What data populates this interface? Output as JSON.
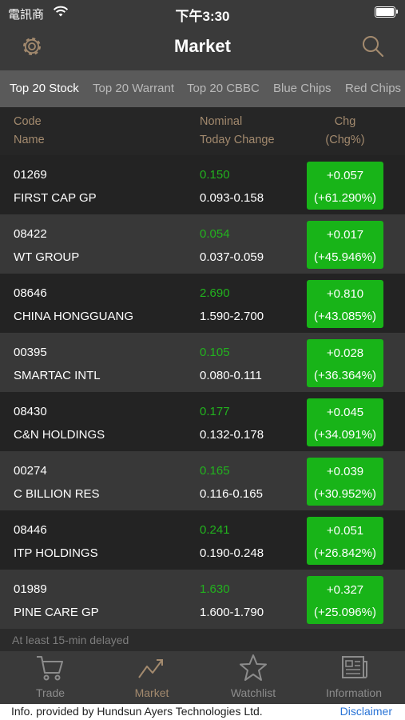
{
  "status": {
    "carrier": "電訊商",
    "time": "下午3:30"
  },
  "nav": {
    "title": "Market",
    "settings_icon": "gear-icon",
    "search_icon": "search-icon"
  },
  "tabs": [
    {
      "label": "Top 20 Stock",
      "active": true
    },
    {
      "label": "Top 20 Warrant",
      "active": false
    },
    {
      "label": "Top 20 CBBC",
      "active": false
    },
    {
      "label": "Blue Chips",
      "active": false
    },
    {
      "label": "Red Chips",
      "active": false
    }
  ],
  "header": {
    "code": "Code",
    "name": "Name",
    "nominal": "Nominal",
    "today_change": "Today Change",
    "chg": "Chg",
    "chg_pct": "(Chg%)"
  },
  "rows": [
    {
      "code": "01269",
      "name": "FIRST CAP GP",
      "nominal": "0.150",
      "range": "0.093-0.158",
      "chg": "+0.057",
      "chg_pct": "(+61.290%)"
    },
    {
      "code": "08422",
      "name": "WT GROUP",
      "nominal": "0.054",
      "range": "0.037-0.059",
      "chg": "+0.017",
      "chg_pct": "(+45.946%)"
    },
    {
      "code": "08646",
      "name": "CHINA HONGGUANG",
      "nominal": "2.690",
      "range": "1.590-2.700",
      "chg": "+0.810",
      "chg_pct": "(+43.085%)"
    },
    {
      "code": "00395",
      "name": "SMARTAC INTL",
      "nominal": "0.105",
      "range": "0.080-0.111",
      "chg": "+0.028",
      "chg_pct": "(+36.364%)"
    },
    {
      "code": "08430",
      "name": "C&N HOLDINGS",
      "nominal": "0.177",
      "range": "0.132-0.178",
      "chg": "+0.045",
      "chg_pct": "(+34.091%)"
    },
    {
      "code": "00274",
      "name": "C BILLION RES",
      "nominal": "0.165",
      "range": "0.116-0.165",
      "chg": "+0.039",
      "chg_pct": "(+30.952%)"
    },
    {
      "code": "08446",
      "name": "ITP HOLDINGS",
      "nominal": "0.241",
      "range": "0.190-0.248",
      "chg": "+0.051",
      "chg_pct": "(+26.842%)"
    },
    {
      "code": "01989",
      "name": "PINE CARE GP",
      "nominal": "1.630",
      "range": "1.600-1.790",
      "chg": "+0.327",
      "chg_pct": "(+25.096%)"
    }
  ],
  "delay_note": "At least 15-min delayed",
  "tabbar": [
    {
      "label": "Trade",
      "icon": "cart-icon",
      "active": false
    },
    {
      "label": "Market",
      "icon": "trend-icon",
      "active": true
    },
    {
      "label": "Watchlist",
      "icon": "star-icon",
      "active": false
    },
    {
      "label": "Information",
      "icon": "newspaper-icon",
      "active": false
    }
  ],
  "footer": {
    "info": "Info. provided by Hundsun Ayers Technologies Ltd.",
    "link": "Disclaimer"
  },
  "colors": {
    "accent": "#a38a6e",
    "up_green": "#18b418",
    "nominal_green": "#22b21e",
    "link_blue": "#2a74d6"
  }
}
